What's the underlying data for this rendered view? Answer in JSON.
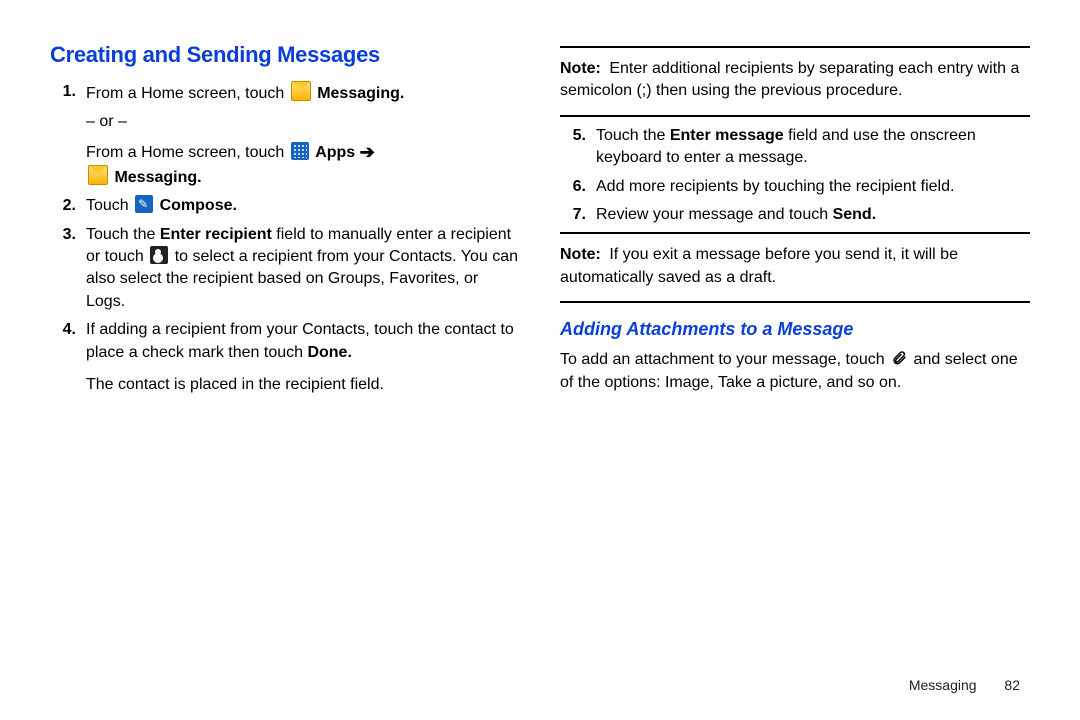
{
  "left": {
    "heading": "Creating and Sending Messages",
    "step1_a": "From a Home screen, touch ",
    "messaging_label": "Messaging",
    "or": "– or –",
    "step1_b": "From a Home screen, touch ",
    "apps_label": "Apps",
    "step2_a": "Touch ",
    "compose_label": "Compose",
    "step3_a": "Touch the ",
    "enter_recipient": "Enter recipient",
    "step3_b": " field to manually enter a recipient or touch ",
    "step3_c": " to select a recipient from your Contacts. You can also select the recipient based on Groups, Favorites, or Logs.",
    "step4_a": "If adding a recipient from your Contacts, touch the contact to place a check mark then touch ",
    "done_label": "Done",
    "step4_sub": "The contact is placed in the recipient field."
  },
  "right": {
    "note_label": "Note:",
    "note1": " Enter additional recipients by separating each entry with a semicolon (;) then using the previous procedure.",
    "step5_a": "Touch the ",
    "enter_message": "Enter message",
    "step5_b": " field and use the onscreen keyboard to enter a message.",
    "step6": "Add more recipients by touching the recipient field.",
    "step7_a": "Review your message and touch ",
    "send_label": "Send",
    "note2": " If you exit a message before you send it, it will be automatically saved as a draft.",
    "sub_heading": "Adding Attachments to a Message",
    "attach_a": "To add an attachment to your message, touch ",
    "attach_b": " and select one of the options: Image, Take a picture, and so on."
  },
  "footer": {
    "section": "Messaging",
    "page": "82"
  }
}
